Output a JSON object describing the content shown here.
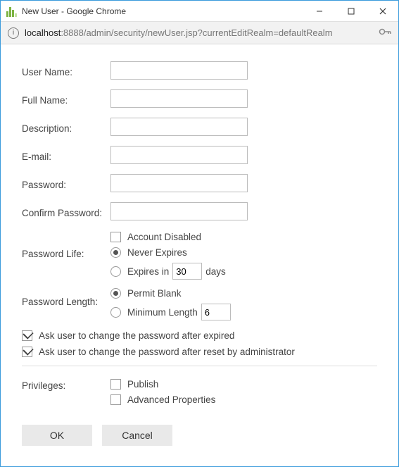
{
  "window": {
    "title": "New User - Google Chrome"
  },
  "address": {
    "host": "localhost",
    "path": ":8888/admin/security/newUser.jsp?currentEditRealm=defaultRealm"
  },
  "labels": {
    "userName": "User Name:",
    "fullName": "Full Name:",
    "description": "Description:",
    "email": "E-mail:",
    "password": "Password:",
    "confirmPassword": "Confirm Password:",
    "passwordLife": "Password Life:",
    "passwordLength": "Password Length:",
    "privileges": "Privileges:"
  },
  "values": {
    "userName": "",
    "fullName": "",
    "description": "",
    "email": "",
    "password": "",
    "confirmPassword": "",
    "expiresDays": "30",
    "minLength": "6"
  },
  "options": {
    "accountDisabled": "Account Disabled",
    "neverExpires": "Never Expires",
    "expiresInPrefix": "Expires in",
    "expiresInSuffix": "days",
    "permitBlank": "Permit Blank",
    "minLengthLabel": "Minimum Length",
    "askAfterExpired": "Ask user to change the password after expired",
    "askAfterReset": "Ask user to change the password after reset by administrator",
    "publish": "Publish",
    "advancedProps": "Advanced Properties"
  },
  "state": {
    "accountDisabled": false,
    "passwordLife": "never",
    "passwordLength": "permitBlank",
    "askAfterExpired": true,
    "askAfterReset": true,
    "publish": false,
    "advancedProps": false
  },
  "buttons": {
    "ok": "OK",
    "cancel": "Cancel"
  }
}
